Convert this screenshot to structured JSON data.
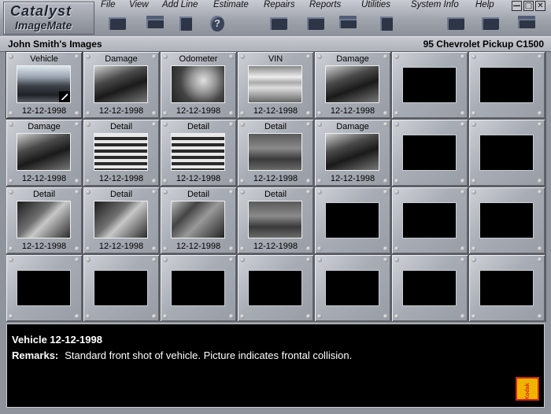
{
  "app": {
    "logo_line1": "Catalyst",
    "logo_line2": "ImageMate"
  },
  "menu": [
    "File",
    "View",
    "Add Line",
    "Estimate",
    "Repairs",
    "Reports",
    "Utilities",
    "System Info",
    "Help"
  ],
  "window_controls": [
    "—",
    "□",
    "✕"
  ],
  "toolbar": [
    {
      "icon": "folder-icon"
    },
    {
      "icon": "stack-icon"
    },
    {
      "icon": "disk-icon"
    },
    {
      "icon": "help-icon",
      "glyph": "?"
    },
    {
      "icon": "open-folder-icon"
    },
    {
      "icon": "folder-icon"
    },
    {
      "icon": "stack-icon"
    },
    {
      "icon": "disk-icon"
    },
    {
      "icon": "pointer-icon"
    },
    {
      "icon": "folder-icon"
    },
    {
      "icon": "stack-icon"
    }
  ],
  "header": {
    "left": "John Smith's Images",
    "right": "95 Chevrolet Pickup C1500"
  },
  "grid": {
    "cells": [
      {
        "label": "Vehicle",
        "date": "12-12-1998",
        "has_image": true,
        "image_hint": "front-view"
      },
      {
        "label": "Damage",
        "date": "12-12-1998",
        "has_image": true,
        "image_hint": "front-damage"
      },
      {
        "label": "Odometer",
        "date": "12-12-1998",
        "has_image": true,
        "image_hint": "odometer"
      },
      {
        "label": "VIN",
        "date": "12-12-1998",
        "has_image": true,
        "image_hint": "vin-plate"
      },
      {
        "label": "Damage",
        "date": "12-12-1998",
        "has_image": true,
        "image_hint": "front-damage"
      },
      {
        "label": "",
        "date": "",
        "has_image": false
      },
      {
        "label": "",
        "date": "",
        "has_image": false
      },
      {
        "label": "Damage",
        "date": "12-12-1998",
        "has_image": true,
        "image_hint": "front-damage"
      },
      {
        "label": "Detail",
        "date": "12-12-1998",
        "has_image": true,
        "image_hint": "grille"
      },
      {
        "label": "Detail",
        "date": "12-12-1998",
        "has_image": true,
        "image_hint": "grille"
      },
      {
        "label": "Detail",
        "date": "12-12-1998",
        "has_image": true,
        "image_hint": "bumper"
      },
      {
        "label": "Damage",
        "date": "12-12-1998",
        "has_image": true,
        "image_hint": "front-damage"
      },
      {
        "label": "",
        "date": "",
        "has_image": false
      },
      {
        "label": "",
        "date": "",
        "has_image": false
      },
      {
        "label": "Detail",
        "date": "12-12-1998",
        "has_image": true,
        "image_hint": "headlight"
      },
      {
        "label": "Detail",
        "date": "12-12-1998",
        "has_image": true,
        "image_hint": "headlight"
      },
      {
        "label": "Detail",
        "date": "12-12-1998",
        "has_image": true,
        "image_hint": "engine"
      },
      {
        "label": "Detail",
        "date": "12-12-1998",
        "has_image": true,
        "image_hint": "bumper"
      },
      {
        "label": "",
        "date": "",
        "has_image": false
      },
      {
        "label": "",
        "date": "",
        "has_image": false
      },
      {
        "label": "",
        "date": "",
        "has_image": false
      },
      {
        "label": "",
        "date": "",
        "has_image": false
      },
      {
        "label": "",
        "date": "",
        "has_image": false
      },
      {
        "label": "",
        "date": "",
        "has_image": false
      },
      {
        "label": "",
        "date": "",
        "has_image": false
      },
      {
        "label": "",
        "date": "",
        "has_image": false
      },
      {
        "label": "",
        "date": "",
        "has_image": false
      },
      {
        "label": "",
        "date": "",
        "has_image": false
      }
    ],
    "selected_index": 0
  },
  "remarks": {
    "title": "Vehicle 12-12-1998",
    "label": "Remarks:",
    "text": "Standard front shot of vehicle. Picture indicates frontal collision."
  },
  "brand": {
    "kodak": "Kodak",
    "accent": "#f0b400"
  }
}
